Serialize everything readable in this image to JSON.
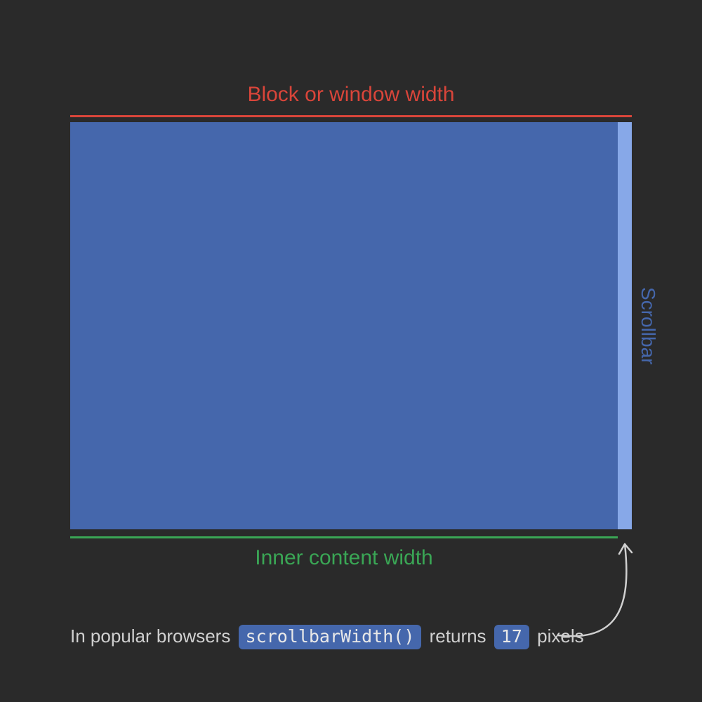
{
  "labels": {
    "top": "Block or window width",
    "bottom": "Inner content width",
    "scrollbar": "Scrollbar"
  },
  "caption": {
    "prefix": "In popular browsers",
    "func": "scrollbarWidth()",
    "middle": "returns",
    "value": "17",
    "suffix": "pixels"
  },
  "colors": {
    "background": "#2a2a2a",
    "block": "#4567ac",
    "scrollbar": "#87a8e8",
    "outerLine": "#d9453a",
    "innerLine": "#3aa655",
    "text": "#d0d0d0"
  }
}
